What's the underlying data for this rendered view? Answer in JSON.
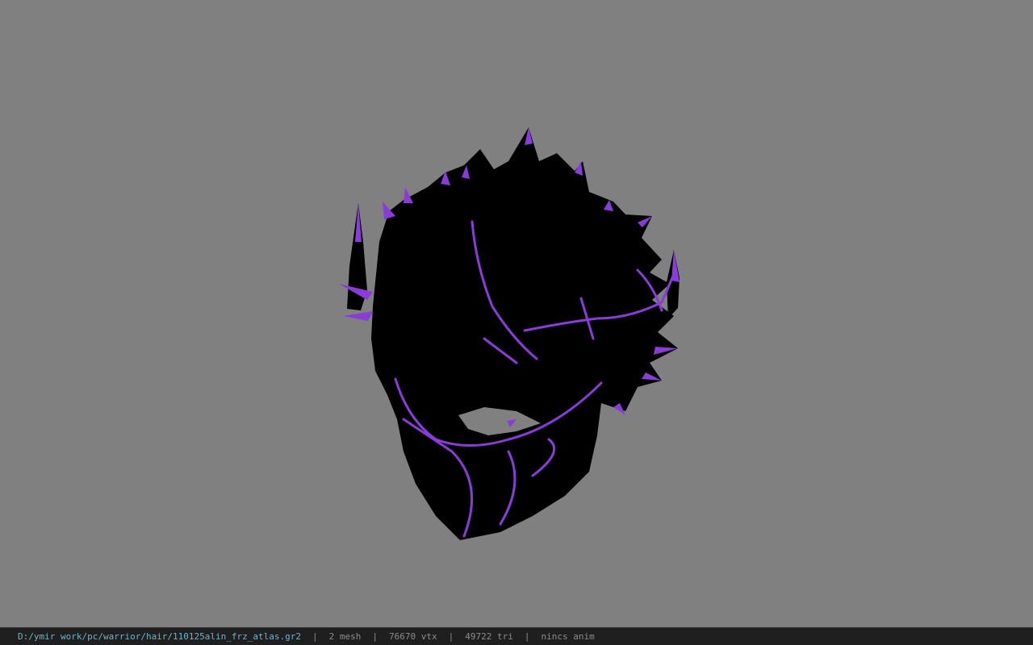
{
  "viewer": {
    "background_color": "#808080",
    "model_color": "#000000",
    "accent_color": "#8a3cd8"
  },
  "status": {
    "file_path": "D:/ymir work/pc/warrior/hair/110125alin_frz_atlas.gr2",
    "separator": "|",
    "mesh": "2 mesh",
    "vtx": "76670 vtx",
    "tri": "49722 tri",
    "anim": "nincs anim"
  }
}
